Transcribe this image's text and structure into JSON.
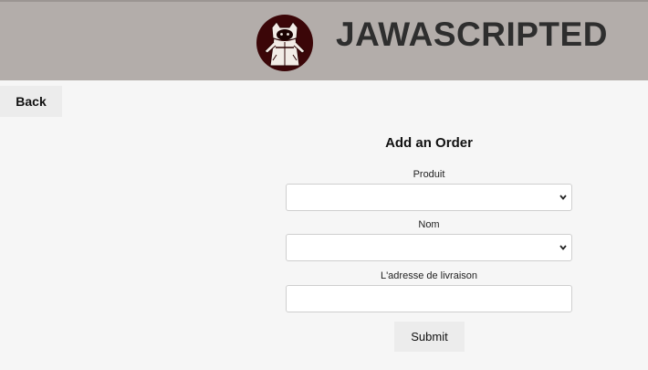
{
  "header": {
    "brand": "JAWASCRIPTED",
    "logo_icon": "hooded-jawa-logo"
  },
  "nav": {
    "back_label": "Back"
  },
  "form": {
    "title": "Add an Order",
    "fields": [
      {
        "label": "Produit",
        "type": "select",
        "value": ""
      },
      {
        "label": "Nom",
        "type": "select",
        "value": ""
      },
      {
        "label": "L'adresse de livraison",
        "type": "text",
        "value": "",
        "placeholder": ""
      }
    ],
    "submit_label": "Submit"
  },
  "colors": {
    "header_bg": "#b3adaa",
    "page_bg": "#f6f6f6",
    "logo_bg": "#3b0608",
    "button_bg": "#ececec"
  }
}
